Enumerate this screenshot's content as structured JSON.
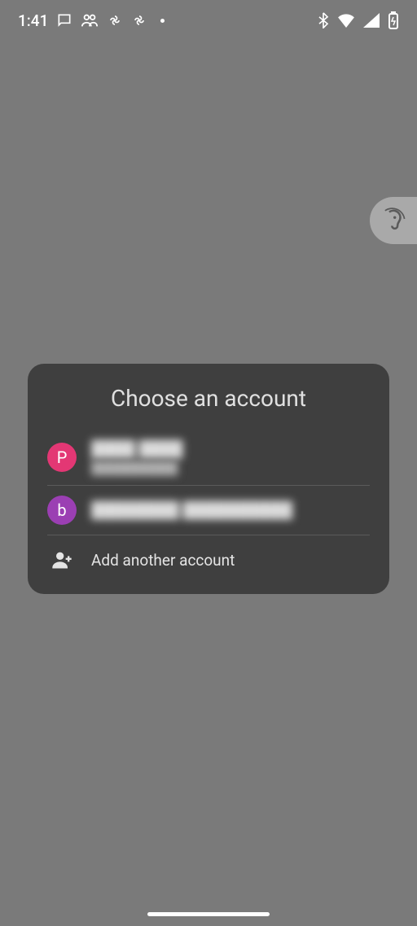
{
  "statusbar": {
    "time": "1:41",
    "notification_icons": [
      "message-icon",
      "people-icon",
      "pinwheel-icon",
      "pinwheel-icon",
      "dot-icon"
    ],
    "system_icons": [
      "bluetooth-icon",
      "wifi-icon",
      "signal-icon",
      "battery-icon"
    ]
  },
  "ear_widget": {
    "icon": "ear-icon"
  },
  "dialog": {
    "title": "Choose an account",
    "accounts": [
      {
        "initial": "P",
        "avatar_color": "#e33774",
        "name": "████ ████",
        "email": "██████████"
      },
      {
        "initial": "b",
        "avatar_color": "#9b3fb3",
        "name": "████████ ██████████",
        "email": ""
      }
    ],
    "add_label": "Add another account"
  }
}
